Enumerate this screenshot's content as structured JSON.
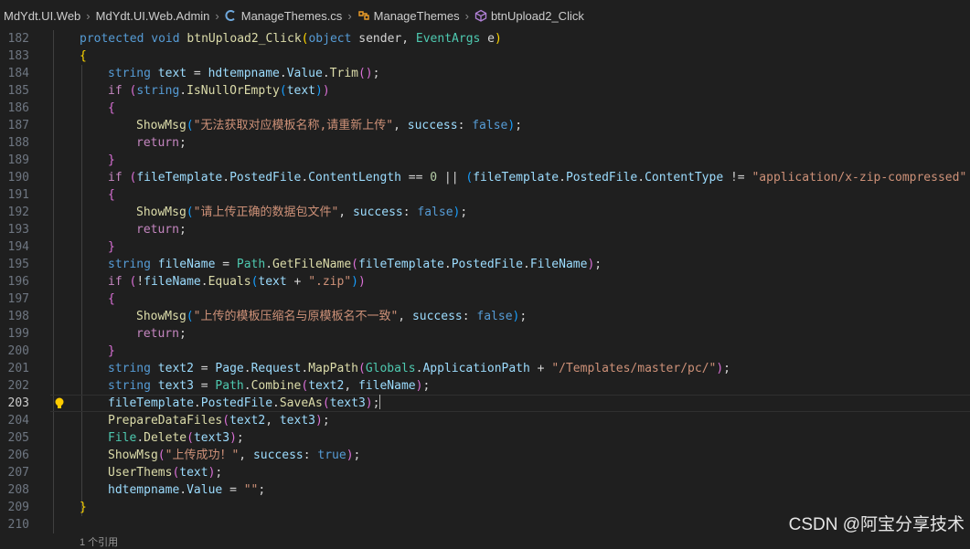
{
  "breadcrumb": {
    "items": [
      "MdYdt.UI.Web",
      "MdYdt.UI.Web.Admin",
      "ManageThemes.cs",
      "ManageThemes",
      "btnUpload2_Click"
    ]
  },
  "editor": {
    "active_line": "203",
    "lines": [
      {
        "num": "182",
        "indent": 0,
        "tokens": [
          [
            "kw",
            "protected"
          ],
          [
            "pl",
            " "
          ],
          [
            "kw",
            "void"
          ],
          [
            "pl",
            " "
          ],
          [
            "fn",
            "btnUpload2_Click"
          ],
          [
            "br1",
            "("
          ],
          [
            "kw",
            "object"
          ],
          [
            "pl",
            " sender, "
          ],
          [
            "cls",
            "EventArgs"
          ],
          [
            "pl",
            " e"
          ],
          [
            "br1",
            ")"
          ]
        ]
      },
      {
        "num": "183",
        "indent": 0,
        "tokens": [
          [
            "br1",
            "{"
          ]
        ]
      },
      {
        "num": "184",
        "indent": 1,
        "tokens": [
          [
            "kw",
            "string"
          ],
          [
            "pl",
            " "
          ],
          [
            "var",
            "text"
          ],
          [
            "pl",
            " = "
          ],
          [
            "var",
            "hdtempname"
          ],
          [
            "pl",
            "."
          ],
          [
            "var",
            "Value"
          ],
          [
            "pl",
            "."
          ],
          [
            "fn",
            "Trim"
          ],
          [
            "br2",
            "()"
          ],
          [
            "pl",
            ";"
          ]
        ]
      },
      {
        "num": "185",
        "indent": 1,
        "tokens": [
          [
            "ctl",
            "if"
          ],
          [
            "pl",
            " "
          ],
          [
            "br2",
            "("
          ],
          [
            "kw",
            "string"
          ],
          [
            "pl",
            "."
          ],
          [
            "fn",
            "IsNullOrEmpty"
          ],
          [
            "br3",
            "("
          ],
          [
            "var",
            "text"
          ],
          [
            "br3",
            ")"
          ],
          [
            "br2",
            ")"
          ]
        ]
      },
      {
        "num": "186",
        "indent": 1,
        "tokens": [
          [
            "br2",
            "{"
          ]
        ]
      },
      {
        "num": "187",
        "indent": 2,
        "tokens": [
          [
            "fn",
            "ShowMsg"
          ],
          [
            "br3",
            "("
          ],
          [
            "str",
            "\"无法获取对应模板名称,请重新上传\""
          ],
          [
            "pl",
            ", "
          ],
          [
            "var",
            "success"
          ],
          [
            "pl",
            ": "
          ],
          [
            "kw",
            "false"
          ],
          [
            "br3",
            ")"
          ],
          [
            "pl",
            ";"
          ]
        ]
      },
      {
        "num": "188",
        "indent": 2,
        "tokens": [
          [
            "ctl",
            "return"
          ],
          [
            "pl",
            ";"
          ]
        ]
      },
      {
        "num": "189",
        "indent": 1,
        "tokens": [
          [
            "br2",
            "}"
          ]
        ]
      },
      {
        "num": "190",
        "indent": 1,
        "tokens": [
          [
            "ctl",
            "if"
          ],
          [
            "pl",
            " "
          ],
          [
            "br2",
            "("
          ],
          [
            "var",
            "fileTemplate"
          ],
          [
            "pl",
            "."
          ],
          [
            "var",
            "PostedFile"
          ],
          [
            "pl",
            "."
          ],
          [
            "var",
            "ContentLength"
          ],
          [
            "pl",
            " == "
          ],
          [
            "num",
            "0"
          ],
          [
            "pl",
            " || "
          ],
          [
            "br3",
            "("
          ],
          [
            "var",
            "fileTemplate"
          ],
          [
            "pl",
            "."
          ],
          [
            "var",
            "PostedFile"
          ],
          [
            "pl",
            "."
          ],
          [
            "var",
            "ContentType"
          ],
          [
            "pl",
            " != "
          ],
          [
            "str",
            "\"application/x-zip-compressed\""
          ],
          [
            "pl",
            " &&"
          ]
        ]
      },
      {
        "num": "191",
        "indent": 1,
        "tokens": [
          [
            "br2",
            "{"
          ]
        ]
      },
      {
        "num": "192",
        "indent": 2,
        "tokens": [
          [
            "fn",
            "ShowMsg"
          ],
          [
            "br3",
            "("
          ],
          [
            "str",
            "\"请上传正确的数据包文件\""
          ],
          [
            "pl",
            ", "
          ],
          [
            "var",
            "success"
          ],
          [
            "pl",
            ": "
          ],
          [
            "kw",
            "false"
          ],
          [
            "br3",
            ")"
          ],
          [
            "pl",
            ";"
          ]
        ]
      },
      {
        "num": "193",
        "indent": 2,
        "tokens": [
          [
            "ctl",
            "return"
          ],
          [
            "pl",
            ";"
          ]
        ]
      },
      {
        "num": "194",
        "indent": 1,
        "tokens": [
          [
            "br2",
            "}"
          ]
        ]
      },
      {
        "num": "195",
        "indent": 1,
        "tokens": [
          [
            "kw",
            "string"
          ],
          [
            "pl",
            " "
          ],
          [
            "var",
            "fileName"
          ],
          [
            "pl",
            " = "
          ],
          [
            "cls",
            "Path"
          ],
          [
            "pl",
            "."
          ],
          [
            "fn",
            "GetFileName"
          ],
          [
            "br2",
            "("
          ],
          [
            "var",
            "fileTemplate"
          ],
          [
            "pl",
            "."
          ],
          [
            "var",
            "PostedFile"
          ],
          [
            "pl",
            "."
          ],
          [
            "var",
            "FileName"
          ],
          [
            "br2",
            ")"
          ],
          [
            "pl",
            ";"
          ]
        ]
      },
      {
        "num": "196",
        "indent": 1,
        "tokens": [
          [
            "ctl",
            "if"
          ],
          [
            "pl",
            " "
          ],
          [
            "br2",
            "("
          ],
          [
            "pl",
            "!"
          ],
          [
            "var",
            "fileName"
          ],
          [
            "pl",
            "."
          ],
          [
            "fn",
            "Equals"
          ],
          [
            "br3",
            "("
          ],
          [
            "var",
            "text"
          ],
          [
            "pl",
            " + "
          ],
          [
            "str",
            "\".zip\""
          ],
          [
            "br3",
            ")"
          ],
          [
            "br2",
            ")"
          ]
        ]
      },
      {
        "num": "197",
        "indent": 1,
        "tokens": [
          [
            "br2",
            "{"
          ]
        ]
      },
      {
        "num": "198",
        "indent": 2,
        "tokens": [
          [
            "fn",
            "ShowMsg"
          ],
          [
            "br3",
            "("
          ],
          [
            "str",
            "\"上传的模板压缩名与原模板名不一致\""
          ],
          [
            "pl",
            ", "
          ],
          [
            "var",
            "success"
          ],
          [
            "pl",
            ": "
          ],
          [
            "kw",
            "false"
          ],
          [
            "br3",
            ")"
          ],
          [
            "pl",
            ";"
          ]
        ]
      },
      {
        "num": "199",
        "indent": 2,
        "tokens": [
          [
            "ctl",
            "return"
          ],
          [
            "pl",
            ";"
          ]
        ]
      },
      {
        "num": "200",
        "indent": 1,
        "tokens": [
          [
            "br2",
            "}"
          ]
        ]
      },
      {
        "num": "201",
        "indent": 1,
        "tokens": [
          [
            "kw",
            "string"
          ],
          [
            "pl",
            " "
          ],
          [
            "var",
            "text2"
          ],
          [
            "pl",
            " = "
          ],
          [
            "var",
            "Page"
          ],
          [
            "pl",
            "."
          ],
          [
            "var",
            "Request"
          ],
          [
            "pl",
            "."
          ],
          [
            "fn",
            "MapPath"
          ],
          [
            "br2",
            "("
          ],
          [
            "cls",
            "Globals"
          ],
          [
            "pl",
            "."
          ],
          [
            "var",
            "ApplicationPath"
          ],
          [
            "pl",
            " + "
          ],
          [
            "str",
            "\"/Templates/master/pc/\""
          ],
          [
            "br2",
            ")"
          ],
          [
            "pl",
            ";"
          ]
        ]
      },
      {
        "num": "202",
        "indent": 1,
        "tokens": [
          [
            "kw",
            "string"
          ],
          [
            "pl",
            " "
          ],
          [
            "var",
            "text3"
          ],
          [
            "pl",
            " = "
          ],
          [
            "cls",
            "Path"
          ],
          [
            "pl",
            "."
          ],
          [
            "fn",
            "Combine"
          ],
          [
            "br2",
            "("
          ],
          [
            "var",
            "text2"
          ],
          [
            "pl",
            ", "
          ],
          [
            "var",
            "fileName"
          ],
          [
            "br2",
            ")"
          ],
          [
            "pl",
            ";"
          ]
        ]
      },
      {
        "num": "203",
        "indent": 1,
        "tokens": [
          [
            "var",
            "fileTemplate"
          ],
          [
            "pl",
            "."
          ],
          [
            "var",
            "PostedFile"
          ],
          [
            "pl",
            "."
          ],
          [
            "fn",
            "SaveAs"
          ],
          [
            "br2",
            "("
          ],
          [
            "var",
            "text3"
          ],
          [
            "br2",
            ")"
          ],
          [
            "pl",
            ";"
          ],
          [
            "cursor",
            ""
          ]
        ]
      },
      {
        "num": "204",
        "indent": 1,
        "tokens": [
          [
            "fn",
            "PrepareDataFiles"
          ],
          [
            "br2",
            "("
          ],
          [
            "var",
            "text2"
          ],
          [
            "pl",
            ", "
          ],
          [
            "var",
            "text3"
          ],
          [
            "br2",
            ")"
          ],
          [
            "pl",
            ";"
          ]
        ]
      },
      {
        "num": "205",
        "indent": 1,
        "tokens": [
          [
            "cls",
            "File"
          ],
          [
            "pl",
            "."
          ],
          [
            "fn",
            "Delete"
          ],
          [
            "br2",
            "("
          ],
          [
            "var",
            "text3"
          ],
          [
            "br2",
            ")"
          ],
          [
            "pl",
            ";"
          ]
        ]
      },
      {
        "num": "206",
        "indent": 1,
        "tokens": [
          [
            "fn",
            "ShowMsg"
          ],
          [
            "br2",
            "("
          ],
          [
            "str",
            "\"上传成功！\""
          ],
          [
            "pl",
            ", "
          ],
          [
            "var",
            "success"
          ],
          [
            "pl",
            ": "
          ],
          [
            "kw",
            "true"
          ],
          [
            "br2",
            ")"
          ],
          [
            "pl",
            ";"
          ]
        ]
      },
      {
        "num": "207",
        "indent": 1,
        "tokens": [
          [
            "fn",
            "UserThems"
          ],
          [
            "br2",
            "("
          ],
          [
            "var",
            "text"
          ],
          [
            "br2",
            ")"
          ],
          [
            "pl",
            ";"
          ]
        ]
      },
      {
        "num": "208",
        "indent": 1,
        "tokens": [
          [
            "var",
            "hdtempname"
          ],
          [
            "pl",
            "."
          ],
          [
            "var",
            "Value"
          ],
          [
            "pl",
            " = "
          ],
          [
            "str",
            "\"\""
          ],
          [
            "pl",
            ";"
          ]
        ]
      },
      {
        "num": "209",
        "indent": 0,
        "tokens": [
          [
            "br1",
            "}"
          ]
        ]
      },
      {
        "num": "210",
        "indent": 0,
        "tokens": []
      }
    ]
  },
  "codelens": "1 个引用",
  "watermark": "CSDN @阿宝分享技术",
  "colors": {
    "background": "#1f1f1f",
    "keyword": "#569cd6",
    "control": "#c586c0",
    "function": "#dcdcaa",
    "string": "#ce9178",
    "variable": "#9cdcfe",
    "type": "#4ec9b0",
    "number": "#b5cea8"
  },
  "icons": [
    "csharp-file-icon",
    "class-icon",
    "method-icon",
    "lightbulb-icon"
  ]
}
